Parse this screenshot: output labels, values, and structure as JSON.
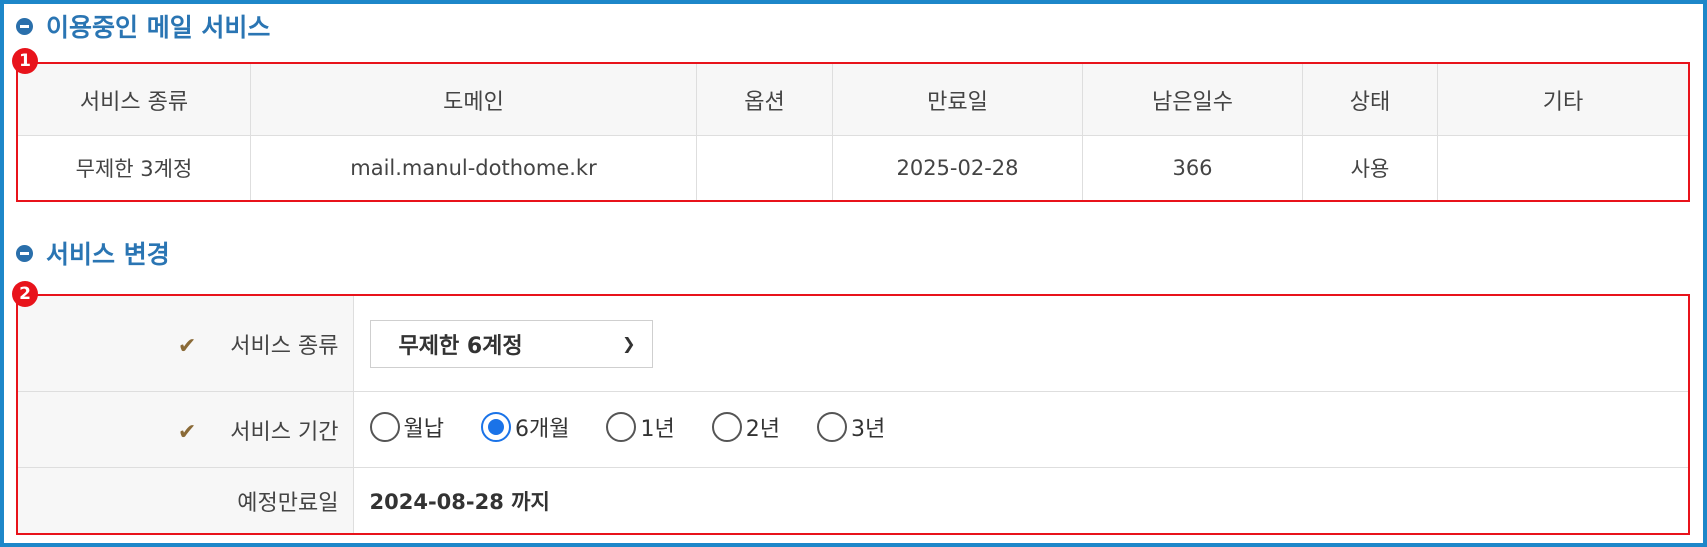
{
  "section_current": {
    "title": "이용중인 메일 서비스",
    "badge": "1"
  },
  "service_table": {
    "headers": [
      "서비스 종류",
      "도메인",
      "옵션",
      "만료일",
      "남은일수",
      "상태",
      "기타"
    ],
    "row": [
      "무제한 3계정",
      "mail.manul-dothome.kr",
      "",
      "2025-02-28",
      "366",
      "사용",
      ""
    ]
  },
  "section_change": {
    "title": "서비스 변경",
    "badge": "2"
  },
  "change_form": {
    "service_type_label": "서비스 종류",
    "service_type_value": "무제한 6계정",
    "period_label": "서비스 기간",
    "period_options": [
      "월납",
      "6개월",
      "1년",
      "2년",
      "3년"
    ],
    "period_selected": "6개월",
    "expiry_label": "예정만료일",
    "expiry_value": "2024-08-28 까지"
  },
  "colors": {
    "frame": "#1d87c9",
    "highlight": "#e8131b",
    "title": "#2a75b3",
    "radio_checked": "#1a73e8"
  }
}
